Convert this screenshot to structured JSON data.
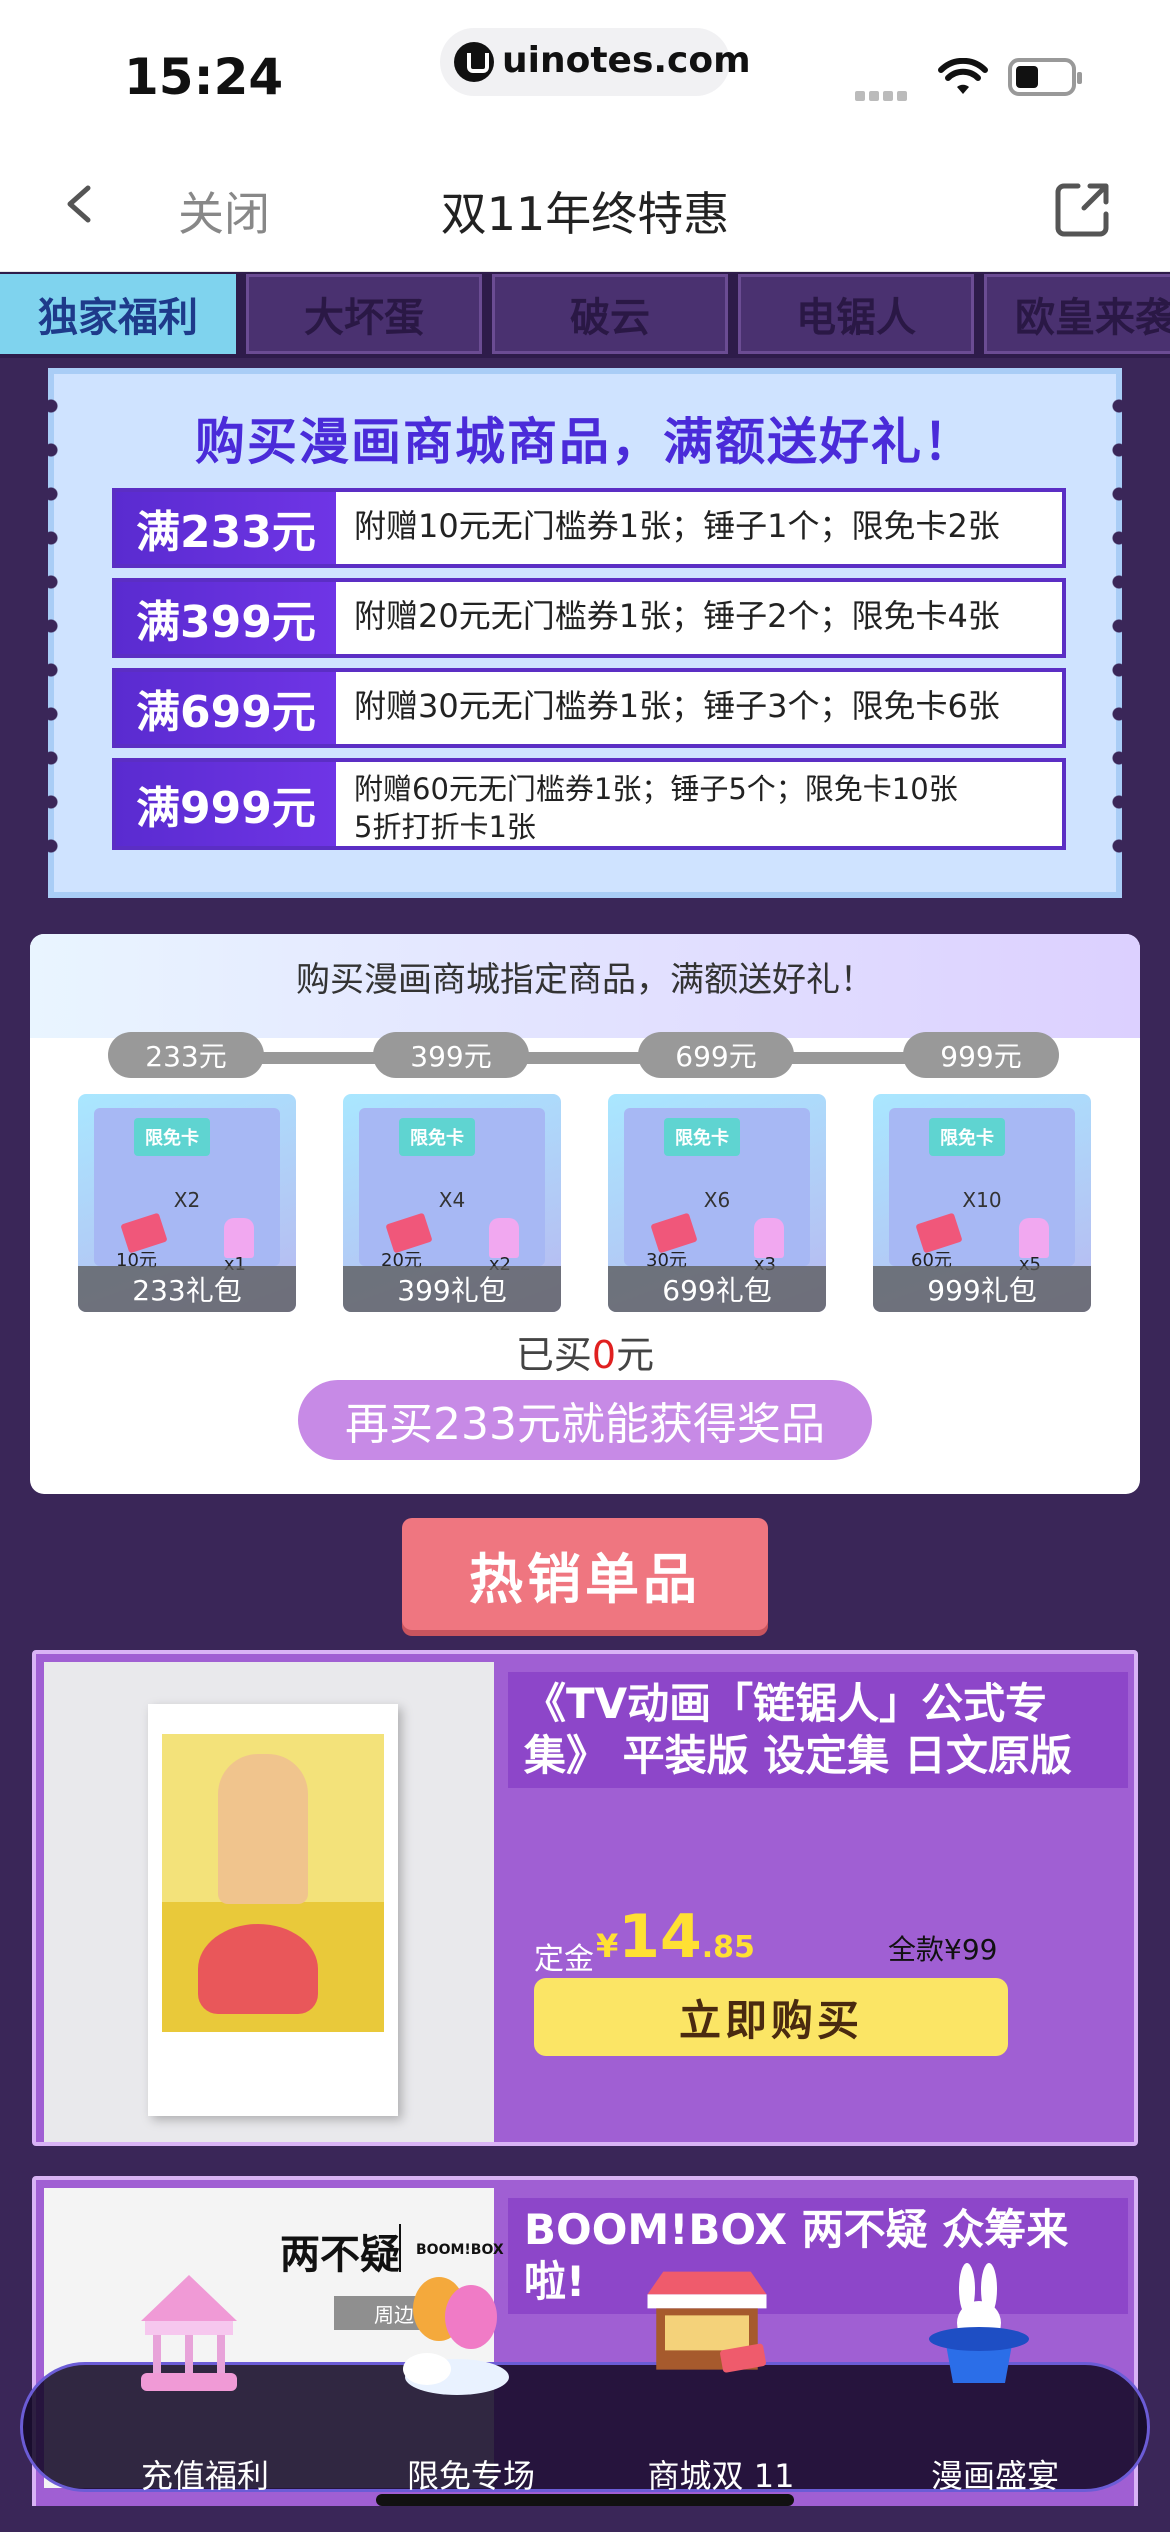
{
  "status": {
    "time": "15:24",
    "url": "uinotes.com"
  },
  "nav": {
    "close_label": "关闭",
    "title": "双11年终特惠"
  },
  "tabs": [
    {
      "label": "独家福利",
      "active": true
    },
    {
      "label": "大坏蛋",
      "active": false
    },
    {
      "label": "破云",
      "active": false
    },
    {
      "label": "电锯人",
      "active": false
    },
    {
      "label": "欧皇来袭",
      "active": false
    }
  ],
  "promo": {
    "title": "购买漫画商城商品，满额送好礼！",
    "tiers": [
      {
        "amount": "满233元",
        "text": "附赠10元无门槛券1张；锤子1个；限免卡2张"
      },
      {
        "amount": "满399元",
        "text": "附赠20元无门槛券1张；锤子2个；限免卡4张"
      },
      {
        "amount": "满699元",
        "text": "附赠30元无门槛券1张；锤子3个；限免卡6张"
      },
      {
        "amount": "满999元",
        "text": "附赠60元无门槛券1张；锤子5个；限免卡10张",
        "text2": "5折打折卡1张"
      }
    ]
  },
  "gift": {
    "title": "购买漫画商城指定商品，满额送好礼！",
    "levels": [
      "233元",
      "399元",
      "699元",
      "999元"
    ],
    "packs": [
      {
        "card": "限免卡",
        "mult": "X2",
        "coupon": "10元",
        "hammer": "x1",
        "label": "233礼包"
      },
      {
        "card": "限免卡",
        "mult": "X4",
        "coupon": "20元",
        "hammer": "x2",
        "label": "399礼包"
      },
      {
        "card": "限免卡",
        "mult": "X6",
        "coupon": "30元",
        "hammer": "x3",
        "label": "699礼包"
      },
      {
        "card": "限免卡",
        "mult": "X10",
        "coupon": "60元",
        "hammer": "x5",
        "label": "999礼包"
      }
    ],
    "bought_prefix": "已买",
    "bought_amount": "0",
    "bought_suffix": "元",
    "more_label": "再买233元就能获得奖品"
  },
  "hot_banner": "热销单品",
  "products": [
    {
      "title": "《TV动画「链锯人」公式专集》 平装版 设定集 日文原版",
      "deposit_label": "定金",
      "yen": "¥",
      "price_int": "14",
      "price_dec": ".85",
      "full_price": "全款¥99",
      "buy_label": "立即购买"
    },
    {
      "title": "BOOM!BOX 两不疑 众筹来啦!",
      "logo": "两不疑",
      "logo2": "BOOM!BOX",
      "tag": "周边"
    }
  ],
  "bottom_tabs": [
    {
      "label": "充值福利",
      "icon": "carousel-icon"
    },
    {
      "label": "限免专场",
      "icon": "balloon-icon"
    },
    {
      "label": "商城双 11",
      "icon": "shop-stall-icon"
    },
    {
      "label": "漫画盛宴",
      "icon": "magic-hat-icon"
    }
  ],
  "colors": {
    "background": "#3a2658",
    "tab_active": "#7fd3ee",
    "tier_purple": "#5a2bd0",
    "product_purple": "#a05fd3",
    "price_yellow": "#ffe033",
    "buy_button": "#fbe565",
    "hot_banner": "#ef7680"
  }
}
